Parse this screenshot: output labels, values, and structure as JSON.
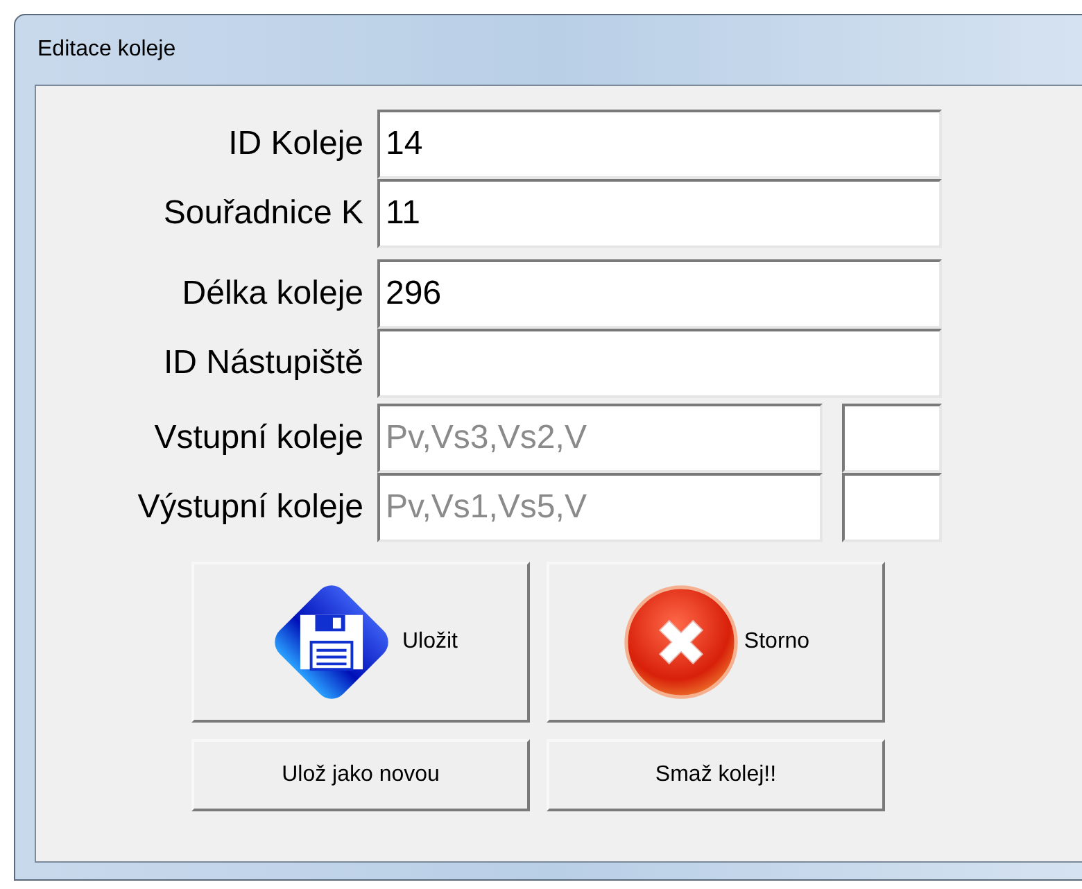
{
  "window": {
    "title": "Editace koleje"
  },
  "fields": [
    {
      "label": "ID Koleje",
      "value": "14",
      "kind": "single"
    },
    {
      "label": "Souřadnice K",
      "value": "11",
      "kind": "single"
    },
    {
      "label": "Délka koleje",
      "value": "296",
      "kind": "single"
    },
    {
      "label": "ID Nástupiště",
      "kind": "single"
    },
    {
      "label": "Vstupní koleje",
      "placeholder": "Pv,Vs3,Vs2,V",
      "kind": "pair"
    },
    {
      "label": "Výstupní koleje",
      "placeholder": "Pv,Vs1,Vs5,V",
      "kind": "pair"
    }
  ],
  "action_buttons": [
    {
      "label": "Uložit",
      "kind": "save"
    },
    {
      "label": "Storno",
      "kind": "cancel"
    }
  ],
  "buttons": [
    "Ulož jako novou",
    "Smaž kolej!!"
  ]
}
